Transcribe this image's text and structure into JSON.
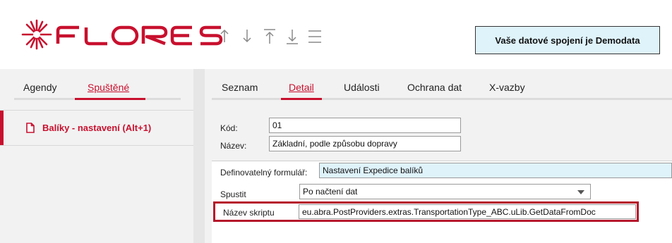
{
  "header": {
    "connection_label": "Vaše datové spojení je Demodata",
    "brand_color": "#c8102e",
    "nav_buttons": [
      "arrow-up",
      "arrow-down",
      "arrow-first",
      "arrow-last",
      "menu"
    ]
  },
  "left_panel": {
    "tabs": [
      {
        "label": "Agendy",
        "active": false
      },
      {
        "label": "Spuštěné",
        "active": true
      }
    ],
    "running_items": [
      {
        "label": "Balíky - nastavení (Alt+1)",
        "icon": "document-icon"
      }
    ]
  },
  "right_panel": {
    "tabs": [
      {
        "label": "Seznam",
        "active": false
      },
      {
        "label": "Detail",
        "active": true
      },
      {
        "label": "Události",
        "active": false
      },
      {
        "label": "Ochrana dat",
        "active": false
      },
      {
        "label": "X-vazby",
        "active": false
      }
    ],
    "fields": {
      "kod_label": "Kód:",
      "kod_value": "01",
      "nazev_label": "Název:",
      "nazev_value": "Základní, podle způsobu dopravy",
      "definovatelny_label": "Definovatelný formulář:",
      "definovatelny_value": "Nastavení Expedice balíků",
      "spustit_label": "Spustit",
      "spustit_value": "Po načtení dat",
      "skript_label": "Název skriptu",
      "skript_value": "eu.abra.PostProviders.extras.TransportationType_ABC.uLib.GetDataFromDoc"
    }
  }
}
